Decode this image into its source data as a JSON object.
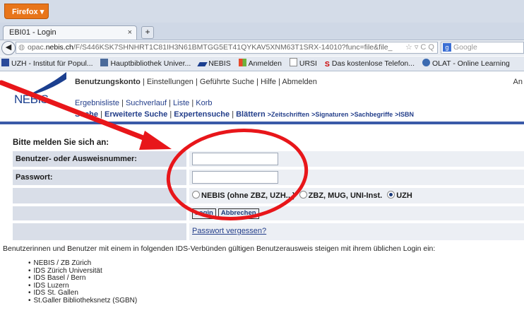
{
  "browser": {
    "menu_button": "Firefox ▾",
    "tab_title": "EBI01 - Login",
    "tab_close": "×",
    "new_tab": "+",
    "url_prefix": "opac.",
    "url_domain": "nebis.ch",
    "url_rest": "/F/S446KSK7SHNHRT1C81IH3N61BMTGG5ET41QYKAV5XNM63T1SRX-14010?func=file&file_",
    "url_icons": "☆ ▿ C Q",
    "search_placeholder": "Google",
    "bookmarks": [
      "UZH - Institut für Popul...",
      "Hauptbibliothek Univer...",
      "NEBIS",
      "Anmelden",
      "URSI",
      "Das kostenlose Telefon...",
      "OLAT - Online Learning"
    ]
  },
  "logo": {
    "text": "NEBIS"
  },
  "topnav": {
    "account": "Benutzungskonto",
    "items": [
      "Einstellungen",
      "Geführte Suche",
      "Hilfe",
      "Abmelden"
    ],
    "right_cut": "An"
  },
  "subnav1": [
    "Ergebnisliste",
    "Suchverlauf",
    "Liste",
    "Korb"
  ],
  "subnav2": {
    "items": [
      "Suche",
      "Erweiterte Suche",
      "Expertensuche",
      "Blättern"
    ],
    "browse_links": [
      ">Zeitschriften",
      ">Signaturen",
      ">Sachbegriffe",
      ">ISBN"
    ]
  },
  "login": {
    "heading": "Bitte melden Sie sich an:",
    "user_label": "Benutzer- oder Ausweisnummer:",
    "user_value": "",
    "password_label": "Passwort:",
    "password_value": "",
    "radio_options": [
      "NEBIS (ohne ZBZ, UZH...)",
      "ZBZ, MUG, UNI-Inst.",
      "UZH"
    ],
    "selected_radio": "UZH",
    "login_button": "Login",
    "cancel_button": "Abbrechen",
    "forgot_link": "Passwort vergessen?"
  },
  "info_text": "Benutzerinnen und Benutzer mit einem in folgenden IDS-Verbünden gültigen Benutzerausweis steigen mit ihrem üblichen Login ein:",
  "ids_list": [
    "NEBIS / ZB Zürich",
    "IDS Zürich Universität",
    "IDS Basel / Bern",
    "IDS Luzern",
    "IDS St. Gallen",
    "St.Galler Bibliotheksnetz (SGBN)"
  ],
  "colors": {
    "annotation_red": "#e8161a",
    "nebis_blue": "#1b3f8f",
    "firefox_orange": "#e8751a"
  }
}
